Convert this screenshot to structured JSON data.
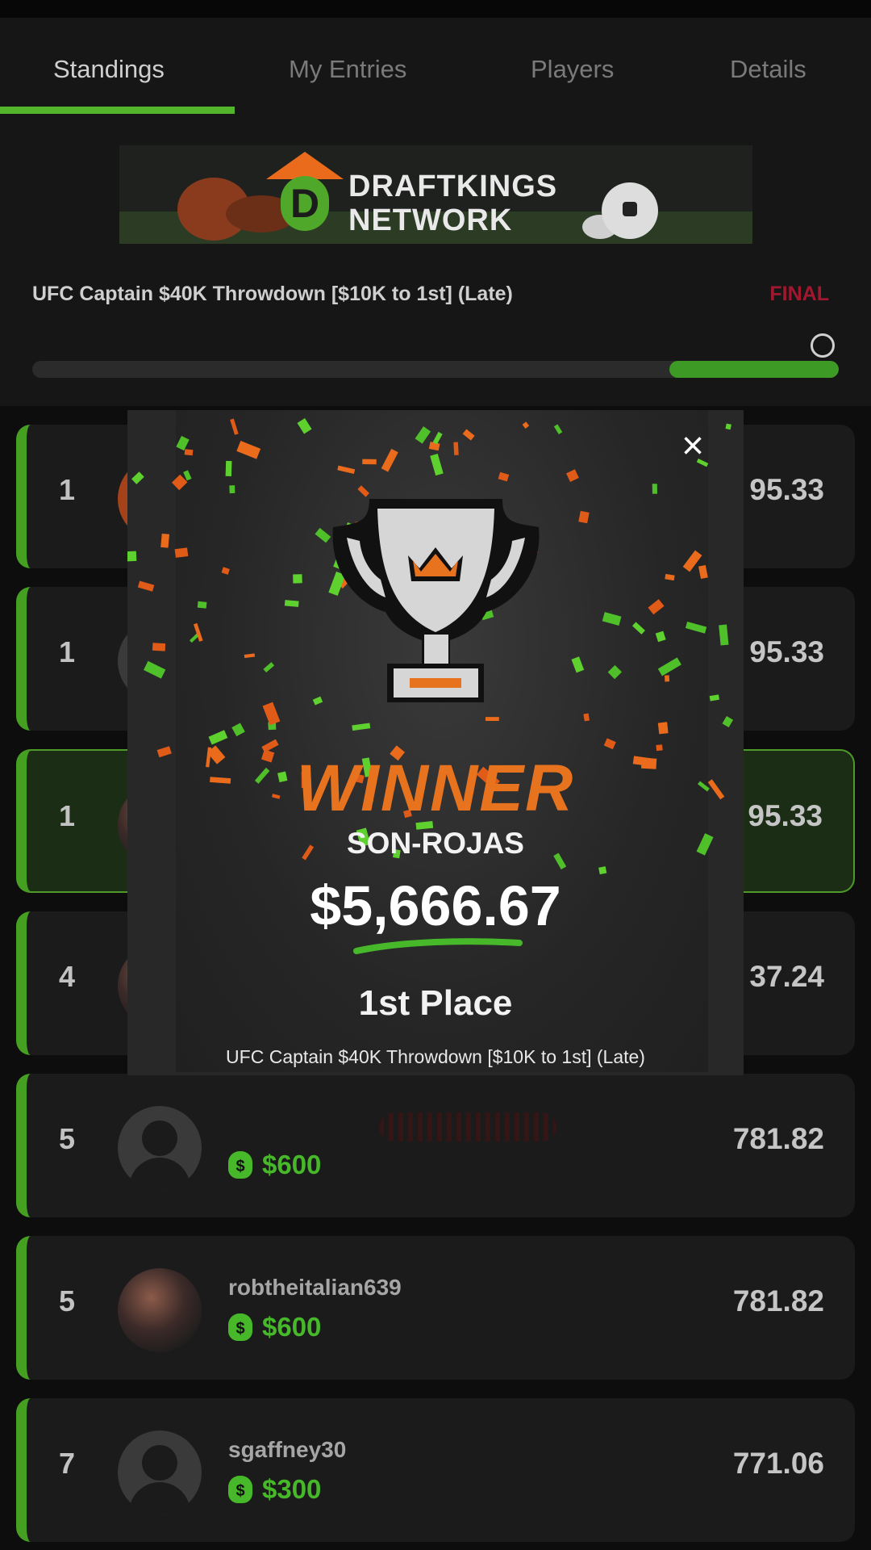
{
  "tabs": [
    {
      "label": "Standings",
      "active": true
    },
    {
      "label": "My Entries",
      "active": false
    },
    {
      "label": "Players",
      "active": false
    },
    {
      "label": "Details",
      "active": false
    }
  ],
  "banner": {
    "line1": "DRAFTKINGS",
    "line2": "NETWORK",
    "logo_letter": "D"
  },
  "contest": {
    "title": "UFC Captain $40K Throwdown [$10K to 1st]  (Late)",
    "status": "FINAL",
    "progress_fraction": 0.79
  },
  "standings": [
    {
      "rank": "1",
      "username": "",
      "prize": "",
      "score": "95.33",
      "avatar": "orange",
      "highlight": false
    },
    {
      "rank": "1",
      "username": "",
      "prize": "",
      "score": "95.33",
      "avatar": "default",
      "highlight": false
    },
    {
      "rank": "1",
      "username": "",
      "prize": "",
      "score": "95.33",
      "avatar": "photo",
      "highlight": true
    },
    {
      "rank": "4",
      "username": "",
      "prize": "",
      "score": "37.24",
      "avatar": "photo",
      "highlight": false
    },
    {
      "rank": "5",
      "username": "",
      "prize": "$600",
      "score": "781.82",
      "avatar": "default",
      "highlight": false
    },
    {
      "rank": "5",
      "username": "robtheitalian639",
      "prize": "$600",
      "score": "781.82",
      "avatar": "photo",
      "highlight": false
    },
    {
      "rank": "7",
      "username": "sgaffney30",
      "prize": "$300",
      "score": "771.06",
      "avatar": "default",
      "highlight": false
    }
  ],
  "modal": {
    "close_icon": "×",
    "headline": "WINNER",
    "winner_name": "SON-ROJAS",
    "amount": "$5,666.67",
    "place": "1st Place",
    "contest_name": "UFC Captain $40K Throwdown [$10K to 1st] (Late)"
  },
  "colors": {
    "accent_green": "#53b52b",
    "prize_green": "#46b82a",
    "final_red": "#a0182f",
    "winner_orange": "#e8731f"
  },
  "icons": {
    "close": "close-icon",
    "prize": "money-bag-icon",
    "trophy": "trophy-icon",
    "progress": "progress-knob-icon"
  }
}
